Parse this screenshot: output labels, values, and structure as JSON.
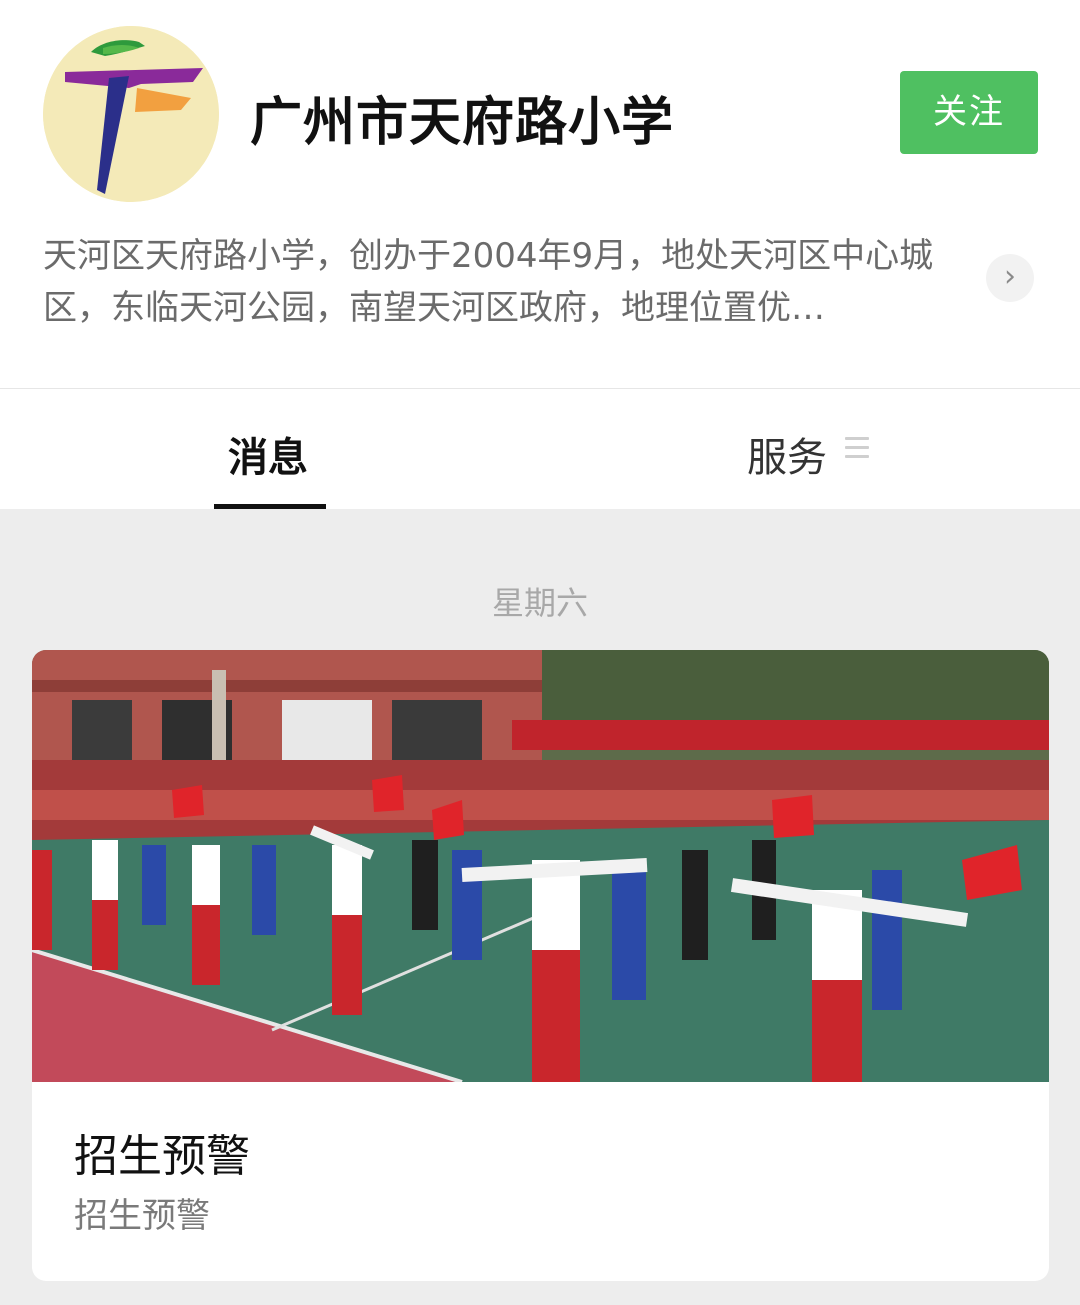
{
  "account": {
    "name": "广州市天府路小学",
    "follow_label": "关注",
    "description": "天河区天府路小学，创办于2004年9月，地处天河区中心城区，东临天河公园，南望天河区政府，地理位置优…"
  },
  "tabs": [
    {
      "label": "消息",
      "active": true
    },
    {
      "label": "服务",
      "active": false
    }
  ],
  "feed": {
    "day_label": "星期六",
    "articles": [
      {
        "title": "招生预警",
        "summary": "招生预警",
        "image": "school-sports-event-photo"
      }
    ]
  },
  "colors": {
    "follow_button": "#4fc061",
    "background": "#ededed"
  },
  "icons": {
    "description_more": "chevron-right-icon",
    "services_menu": "menu-icon"
  }
}
